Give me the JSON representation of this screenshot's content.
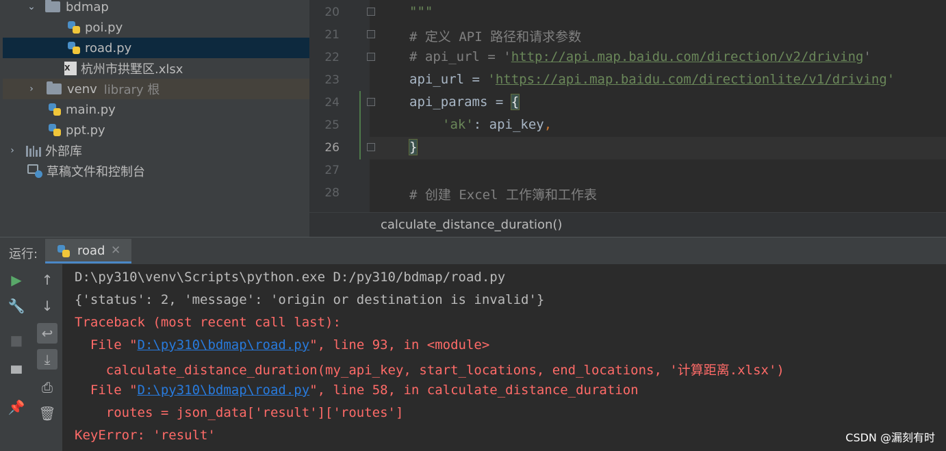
{
  "tree": {
    "bdmap": "bdmap",
    "poi": "poi.py",
    "road": "road.py",
    "xlsx": "杭州市拱墅区.xlsx",
    "xlsx_icon": "X",
    "venv": "venv",
    "venv_hint": "library 根",
    "main": "main.py",
    "ppt": "ppt.py",
    "external": "外部库",
    "scratch": "草稿文件和控制台"
  },
  "editor": {
    "line_numbers": [
      "20",
      "21",
      "22",
      "23",
      "24",
      "25",
      "26",
      "27",
      "28"
    ],
    "current_line": "26",
    "l20": "\"\"\"",
    "l21": "# 定义 API 路径和请求参数",
    "l22_pre": "# api_url = '",
    "l22_url": "http://api.map.baidu.com/direction/v2/driving",
    "l22_post": "'",
    "l23_pre": "api_url = ",
    "l23_q1": "'",
    "l23_url": "https://api.map.baidu.com/directionlite/v1/driving",
    "l23_q2": "'",
    "l24_pre": "api_params = ",
    "l24_brace": "{",
    "l25_key": "'ak'",
    "l25_rest": ": api_key",
    "l25_comma": ",",
    "l26_brace": "}",
    "l28": "# 创建 Excel 工作簿和工作表",
    "breadcrumb": "calculate_distance_duration()"
  },
  "run": {
    "label": "运行:",
    "tab": "road",
    "close": "✕"
  },
  "console": {
    "cmd": "D:\\py310\\venv\\Scripts\\python.exe D:/py310/bdmap/road.py",
    "resp": "{'status': 2, 'message': 'origin or destination is invalid'}",
    "tb": "Traceback (most recent call last):",
    "f1_pre": "  File \"",
    "f1_link": "D:\\py310\\bdmap\\road.py",
    "f1_post": "\", line 93, in <module>",
    "f1_code": "    calculate_distance_duration(my_api_key, start_locations, end_locations, '计算距离.xlsx')",
    "f2_pre": "  File \"",
    "f2_link": "D:\\py310\\bdmap\\road.py",
    "f2_post": "\", line 58, in calculate_distance_duration",
    "f2_code": "    routes = json_data['result']['routes']",
    "err": "KeyError: 'result'"
  },
  "watermark": "CSDN @漏刻有时",
  "icons": [
    "folder-icon",
    "python-file-icon",
    "excel-file-icon",
    "library-icon",
    "scratch-icon",
    "play-icon",
    "wrench-icon",
    "stop-icon",
    "layout-icon",
    "pin-icon",
    "up-arrow-icon",
    "down-arrow-icon",
    "soft-wrap-icon",
    "scroll-to-end-icon",
    "print-icon",
    "trash-icon"
  ],
  "colors": {
    "error": "#ff6b68",
    "link": "#287bde",
    "comment": "#808080",
    "string": "#6a8759",
    "selection": "#0d293e"
  }
}
